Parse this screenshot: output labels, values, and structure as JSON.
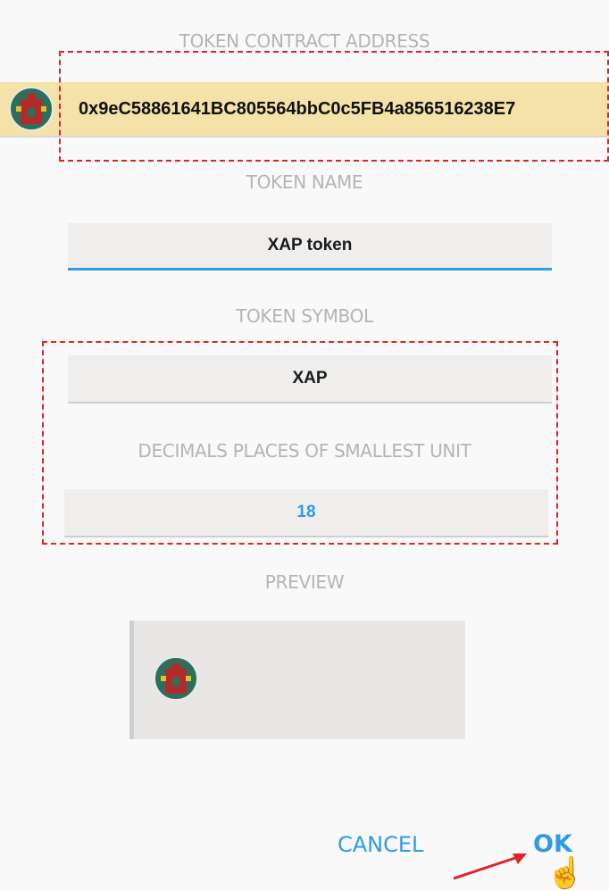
{
  "contract": {
    "label": "TOKEN CONTRACT ADDRESS",
    "address": "0x9eC58861641BC805564bbC0c5FB4a856516238E7"
  },
  "token_name": {
    "label": "TOKEN NAME",
    "value": "XAP token"
  },
  "token_symbol": {
    "label": "TOKEN SYMBOL",
    "value": "XAP"
  },
  "decimals": {
    "label": "DECIMALS PLACES OF SMALLEST UNIT",
    "value": "18"
  },
  "preview": {
    "label": "PREVIEW"
  },
  "actions": {
    "cancel": "CANCEL",
    "ok": "OK"
  },
  "icons": {
    "token": "token-identicon",
    "pointer": "hand-pointer-icon"
  },
  "colors": {
    "accent": "#2e9be6",
    "highlight": "#f5e2a8",
    "annotation": "#e02424"
  }
}
